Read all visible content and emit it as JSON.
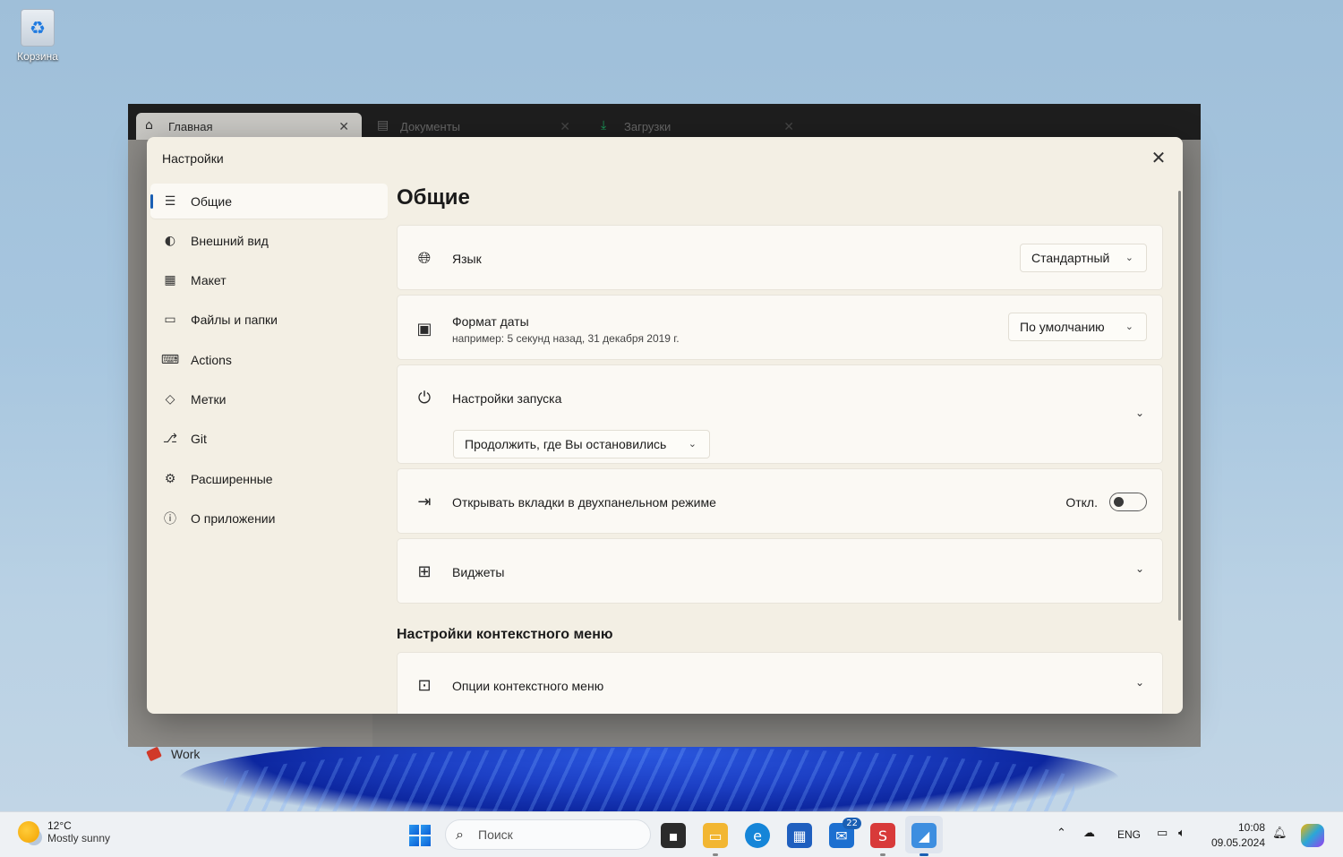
{
  "desktop": {
    "recycle_bin_label": "Корзина"
  },
  "background_app": {
    "tabs": [
      {
        "label": "Главная"
      },
      {
        "label": "Документы"
      },
      {
        "label": "Загрузки"
      }
    ],
    "sidebar_tag": "Work"
  },
  "dialog": {
    "title": "Настройки",
    "close_glyph": "✕",
    "nav": [
      {
        "label": "Общие",
        "icon": "sliders-icon",
        "active": true
      },
      {
        "label": "Внешний вид",
        "icon": "palette-icon"
      },
      {
        "label": "Макет",
        "icon": "grid-icon"
      },
      {
        "label": "Файлы и папки",
        "icon": "folder-icon"
      },
      {
        "label": "Actions",
        "icon": "keyboard-icon"
      },
      {
        "label": "Метки",
        "icon": "tag-icon"
      },
      {
        "label": "Git",
        "icon": "git-icon"
      },
      {
        "label": "Расширенные",
        "icon": "gears-icon"
      },
      {
        "label": "О приложении",
        "icon": "info-icon"
      }
    ],
    "page_title": "Общие",
    "settings": {
      "language": {
        "label": "Язык",
        "value": "Стандартный"
      },
      "date_format": {
        "label": "Формат даты",
        "example": "например: 5 секунд назад, 31 декабря 2019 г.",
        "value": "По умолчанию"
      },
      "startup": {
        "label": "Настройки запуска",
        "value": "Продолжить, где Вы остановились"
      },
      "dual_pane": {
        "label": "Открывать вкладки в двухпанельном режиме",
        "state_label": "Откл.",
        "enabled": false
      },
      "widgets": {
        "label": "Виджеты"
      }
    },
    "context_section_title": "Настройки контекстного меню",
    "context_options": {
      "label": "Опции контекстного меню"
    }
  },
  "taskbar": {
    "weather": {
      "temp": "12°C",
      "condition": "Mostly sunny"
    },
    "search_placeholder": "Поиск",
    "mail_badge": "22",
    "language": "ENG",
    "time": "10:08",
    "date": "09.05.2024"
  }
}
